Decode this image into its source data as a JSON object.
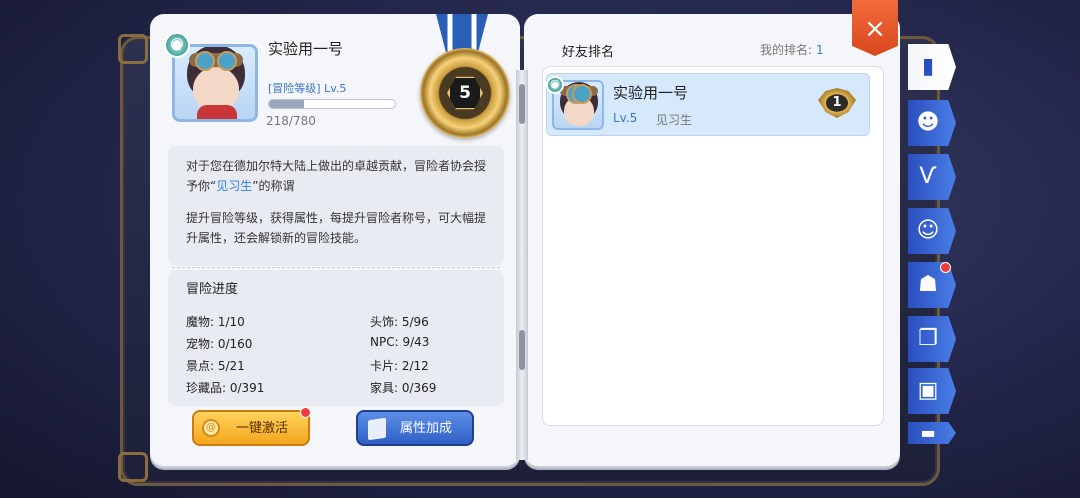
{
  "player": {
    "name": "实验用一号",
    "level_label": "[冒险等级] Lv.5",
    "xp_text": "218/780",
    "xp_fraction": 0.28,
    "medal_level": "5"
  },
  "description": {
    "line1_prefix": "对于您在德加尔特大陆上做出的卓越贡献，冒险者协会授予你“",
    "line1_title": "见习生",
    "line1_suffix": "”的称谓",
    "line2": "提升冒险等级，获得属性，每提升冒险者称号，可大幅提升属性，还会解锁新的冒险技能。"
  },
  "progress": {
    "title": "冒险进度",
    "stats": [
      {
        "label": "魔物: 1/10"
      },
      {
        "label": "头饰: 5/96"
      },
      {
        "label": "宠物: 0/160"
      },
      {
        "label": "NPC: 9/43"
      },
      {
        "label": "景点: 5/21"
      },
      {
        "label": "卡片: 2/12"
      },
      {
        "label": "珍藏品: 0/391"
      },
      {
        "label": "家具: 0/369"
      }
    ]
  },
  "buttons": {
    "activate_label": "一键激活",
    "attr_label": "属性加成"
  },
  "ranking": {
    "title": "好友排名",
    "my_rank_label": "我的排名:",
    "my_rank_value": "1",
    "rows": [
      {
        "name": "实验用一号",
        "level": "Lv.5",
        "title": "见习生",
        "rank": "1"
      }
    ]
  },
  "close_label": "×",
  "tabs": [
    {
      "icon": "book-icon",
      "glyph": "▮"
    },
    {
      "icon": "grin-monster-icon",
      "glyph": "☻"
    },
    {
      "icon": "horns-icon",
      "glyph": "Ѵ"
    },
    {
      "icon": "pet-face-icon",
      "glyph": "☺"
    },
    {
      "icon": "npc-icon",
      "glyph": "☗"
    },
    {
      "icon": "map-icon",
      "glyph": "❐"
    },
    {
      "icon": "card-icon",
      "glyph": "▣"
    },
    {
      "icon": "furniture-icon",
      "glyph": "▬"
    }
  ],
  "colors": {
    "accent_blue": "#2f7ed8",
    "orange_button": "#f4a51d",
    "blue_button": "#2f5fc4",
    "close_red": "#d9461f"
  }
}
